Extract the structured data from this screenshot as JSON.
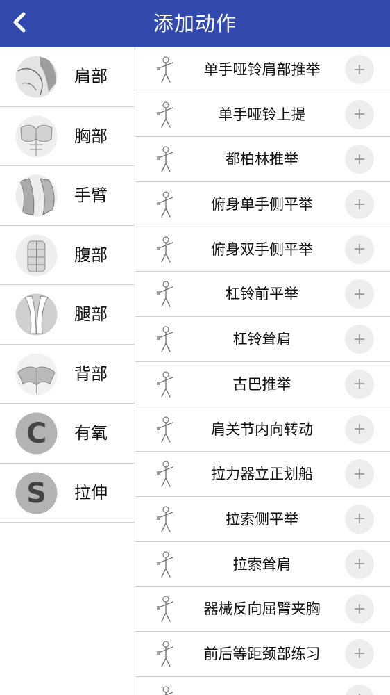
{
  "header": {
    "title": "添加动作",
    "back_icon": "chevron-left-icon",
    "bg_color": "#3249ae"
  },
  "categories": [
    {
      "label": "肩部",
      "icon": "shoulder-icon"
    },
    {
      "label": "胸部",
      "icon": "chest-icon"
    },
    {
      "label": "手臂",
      "icon": "arm-icon"
    },
    {
      "label": "腹部",
      "icon": "abs-icon"
    },
    {
      "label": "腿部",
      "icon": "leg-icon"
    },
    {
      "label": "背部",
      "icon": "back-icon"
    },
    {
      "label": "有氧",
      "icon": "letter-c-icon",
      "letter": "C"
    },
    {
      "label": "拉伸",
      "icon": "letter-s-icon",
      "letter": "S"
    }
  ],
  "exercises": [
    {
      "label": "单手哑铃肩部推举",
      "add": "+"
    },
    {
      "label": "单手哑铃上提",
      "add": "+"
    },
    {
      "label": "都柏林推举",
      "add": "+"
    },
    {
      "label": "俯身单手侧平举",
      "add": "+"
    },
    {
      "label": "俯身双手侧平举",
      "add": "+"
    },
    {
      "label": "杠铃前平举",
      "add": "+"
    },
    {
      "label": "杠铃耸肩",
      "add": "+"
    },
    {
      "label": "古巴推举",
      "add": "+"
    },
    {
      "label": "肩关节内向转动",
      "add": "+"
    },
    {
      "label": "拉力器立正划船",
      "add": "+"
    },
    {
      "label": "拉索侧平举",
      "add": "+"
    },
    {
      "label": "拉索耸肩",
      "add": "+"
    },
    {
      "label": "器械反向屈臂夹胸",
      "add": "+"
    },
    {
      "label": "前后等距颈部练习",
      "add": "+"
    },
    {
      "label": "",
      "add": "+"
    }
  ]
}
